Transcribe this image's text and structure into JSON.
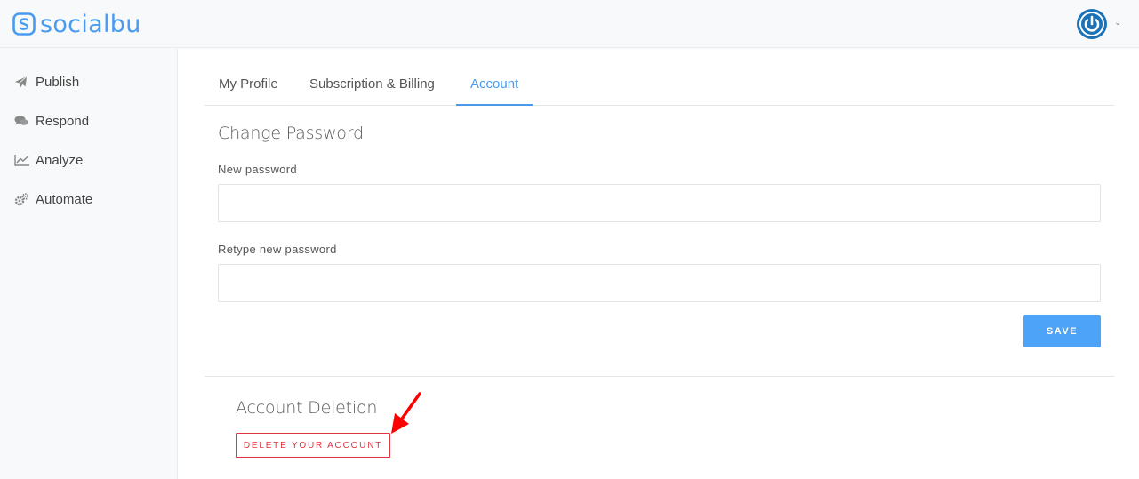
{
  "brand": {
    "name": "socialbu",
    "color": "#4a9bf0"
  },
  "header": {
    "avatar_icon": "power-icon",
    "caret_icon": "chevron-down-icon"
  },
  "sidebar": {
    "items": [
      {
        "label": "Publish",
        "icon": "paper-plane-icon"
      },
      {
        "label": "Respond",
        "icon": "comments-icon"
      },
      {
        "label": "Analyze",
        "icon": "line-chart-icon"
      },
      {
        "label": "Automate",
        "icon": "gears-icon"
      }
    ]
  },
  "tabs": [
    {
      "label": "My Profile",
      "active": false
    },
    {
      "label": "Subscription & Billing",
      "active": false
    },
    {
      "label": "Account",
      "active": true
    }
  ],
  "change_password": {
    "title": "Change Password",
    "new_password_label": "New password",
    "new_password_value": "",
    "retype_label": "Retype new password",
    "retype_value": "",
    "save_label": "SAVE"
  },
  "account_deletion": {
    "title": "Account Deletion",
    "delete_label": "DELETE YOUR ACCOUNT"
  },
  "colors": {
    "accent": "#4a9bf0",
    "danger": "#e0343f",
    "annotation_arrow": "#ff0000"
  }
}
